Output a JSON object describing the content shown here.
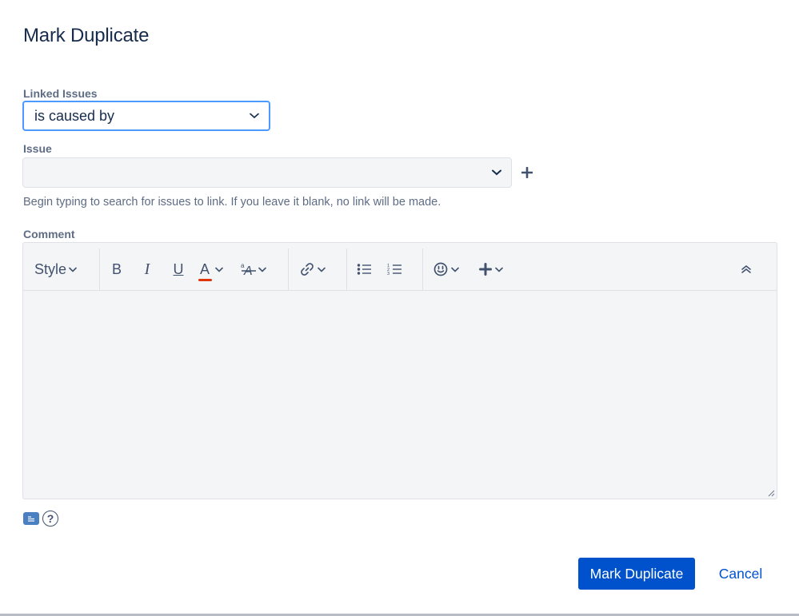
{
  "dialog": {
    "title": "Mark Duplicate"
  },
  "linked_issues": {
    "label": "Linked Issues",
    "selected": "is caused by"
  },
  "issue": {
    "label": "Issue",
    "value": "",
    "help": "Begin typing to search for issues to link. If you leave it blank, no link will be made."
  },
  "comment": {
    "label": "Comment",
    "value": "",
    "toolbar": {
      "style_label": "Style",
      "bold": "B",
      "italic": "I",
      "underline": "U",
      "text_color": "A",
      "text_color_value": "#de350b"
    }
  },
  "footer": {
    "help_icon": "?"
  },
  "actions": {
    "primary_label": "Mark Duplicate",
    "cancel_label": "Cancel"
  },
  "colors": {
    "primary": "#0052cc",
    "focus": "#4c9aff",
    "text": "#172b4d",
    "subtle": "#5e6c84"
  }
}
